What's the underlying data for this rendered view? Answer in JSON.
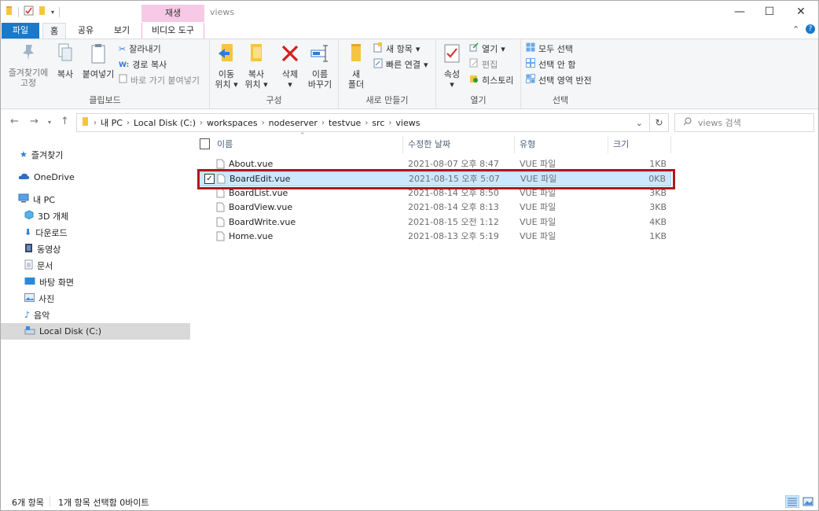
{
  "window": {
    "title": "views",
    "context_tab_header": "재생"
  },
  "tabs": {
    "file": "파일",
    "home": "홈",
    "share": "공유",
    "view": "보기",
    "video_tools": "비디오 도구"
  },
  "ribbon": {
    "clipboard": {
      "label": "클립보드",
      "pin": "즐겨찾기에\n고정",
      "pin_l1": "즐겨찾기에",
      "pin_l2": "고정",
      "copy": "복사",
      "paste": "붙여넣기",
      "cut": "잘라내기",
      "copy_path": "경로 복사",
      "paste_shortcut": "바로 가기 붙여넣기"
    },
    "organize": {
      "label": "구성",
      "move_l1": "이동",
      "move_l2": "위치",
      "copyto_l1": "복사",
      "copyto_l2": "위치",
      "delete": "삭제",
      "rename_l1": "이름",
      "rename_l2": "바꾸기"
    },
    "new": {
      "label": "새로 만들기",
      "folder_l1": "새",
      "folder_l2": "폴더",
      "new_item": "새 항목",
      "easy_access": "빠른 연결"
    },
    "open": {
      "label": "열기",
      "properties": "속성",
      "open": "열기",
      "edit": "편집",
      "history": "히스토리"
    },
    "select": {
      "label": "선택",
      "select_all": "모두 선택",
      "select_none": "선택 안 함",
      "invert": "선택 영역 반전"
    }
  },
  "address": {
    "crumbs": [
      "내 PC",
      "Local Disk (C:)",
      "workspaces",
      "nodeserver",
      "testvue",
      "src",
      "views"
    ],
    "search_placeholder": "views 검색"
  },
  "navpane": {
    "quick_access": "즐겨찾기",
    "onedrive": "OneDrive",
    "this_pc": "내 PC",
    "objects3d": "3D 개체",
    "downloads": "다운로드",
    "videos": "동영상",
    "documents": "문서",
    "desktop": "바탕 화면",
    "pictures": "사진",
    "music": "음악",
    "local_disk": "Local Disk (C:)"
  },
  "columns": {
    "name": "이름",
    "modified": "수정한 날짜",
    "type": "유형",
    "size": "크기"
  },
  "files": [
    {
      "name": "About.vue",
      "modified": "2021-08-07 오후 8:47",
      "type": "VUE 파일",
      "size": "1KB"
    },
    {
      "name": "BoardEdit.vue",
      "modified": "2021-08-15 오후 5:07",
      "type": "VUE 파일",
      "size": "0KB"
    },
    {
      "name": "BoardList.vue",
      "modified": "2021-08-14 오후 8:50",
      "type": "VUE 파일",
      "size": "3KB"
    },
    {
      "name": "BoardView.vue",
      "modified": "2021-08-14 오후 8:13",
      "type": "VUE 파일",
      "size": "3KB"
    },
    {
      "name": "BoardWrite.vue",
      "modified": "2021-08-15 오전 1:12",
      "type": "VUE 파일",
      "size": "4KB"
    },
    {
      "name": "Home.vue",
      "modified": "2021-08-13 오후 5:19",
      "type": "VUE 파일",
      "size": "1KB"
    }
  ],
  "status": {
    "count": "6개 항목",
    "selection": "1개 항목 선택함 0바이트"
  },
  "colors": {
    "file_tab": "#1979ca",
    "context_tab": "#f7c9e6",
    "selection": "#cce8ff",
    "highlight_border": "#b3171c"
  }
}
